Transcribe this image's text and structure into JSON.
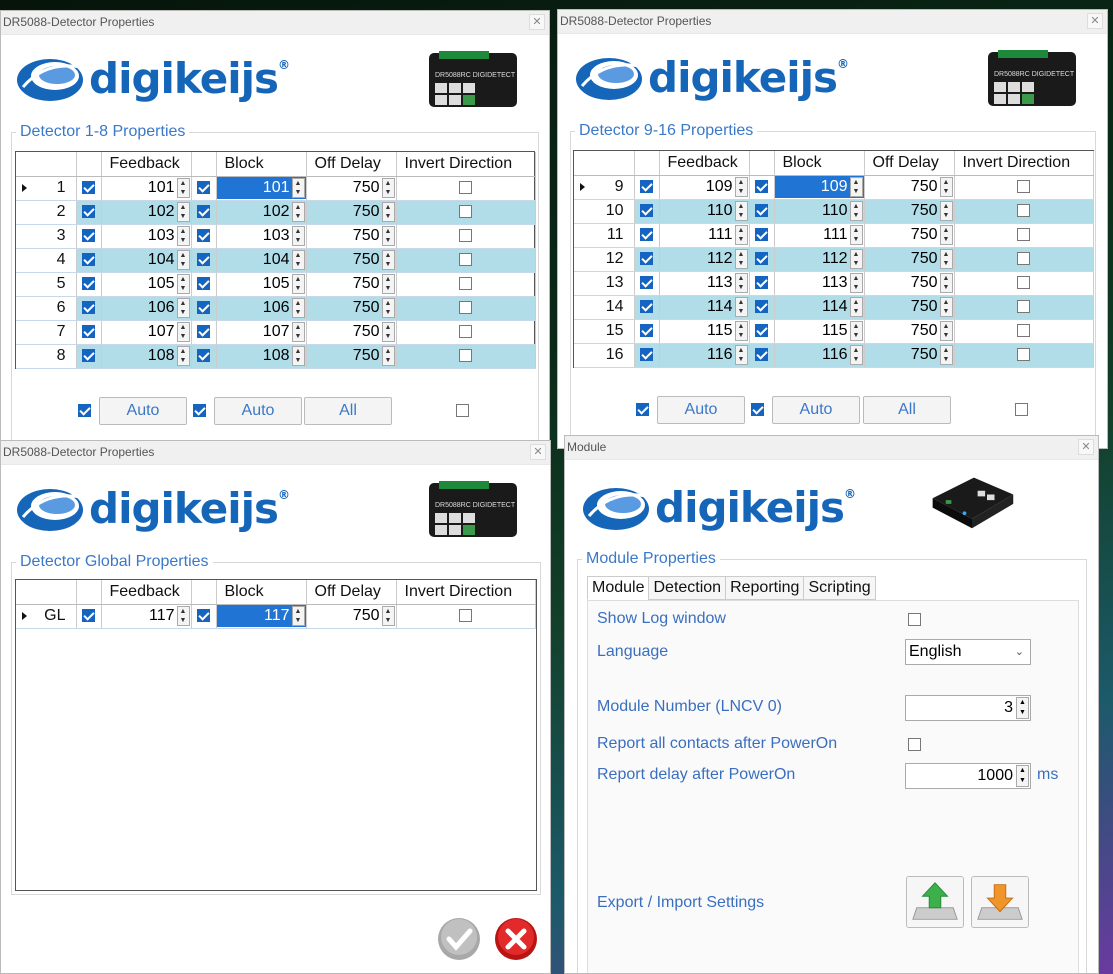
{
  "win1": {
    "title": "DR5088-Detector Properties",
    "legend": "Detector 1-8 Properties",
    "headers": [
      "Feedback",
      "Block",
      "Off Delay",
      "Invert Direction"
    ],
    "rows": [
      {
        "n": "1",
        "fb": "101",
        "bl": "101",
        "od": "750"
      },
      {
        "n": "2",
        "fb": "102",
        "bl": "102",
        "od": "750"
      },
      {
        "n": "3",
        "fb": "103",
        "bl": "103",
        "od": "750"
      },
      {
        "n": "4",
        "fb": "104",
        "bl": "104",
        "od": "750"
      },
      {
        "n": "5",
        "fb": "105",
        "bl": "105",
        "od": "750"
      },
      {
        "n": "6",
        "fb": "106",
        "bl": "106",
        "od": "750"
      },
      {
        "n": "7",
        "fb": "107",
        "bl": "107",
        "od": "750"
      },
      {
        "n": "8",
        "fb": "108",
        "bl": "108",
        "od": "750"
      }
    ],
    "auto1": "Auto",
    "auto2": "Auto",
    "all": "All"
  },
  "win2": {
    "title": "DR5088-Detector Properties",
    "legend": "Detector 9-16 Properties",
    "headers": [
      "Feedback",
      "Block",
      "Off Delay",
      "Invert Direction"
    ],
    "rows": [
      {
        "n": "9",
        "fb": "109",
        "bl": "109",
        "od": "750"
      },
      {
        "n": "10",
        "fb": "110",
        "bl": "110",
        "od": "750"
      },
      {
        "n": "11",
        "fb": "111",
        "bl": "111",
        "od": "750"
      },
      {
        "n": "12",
        "fb": "112",
        "bl": "112",
        "od": "750"
      },
      {
        "n": "13",
        "fb": "113",
        "bl": "113",
        "od": "750"
      },
      {
        "n": "14",
        "fb": "114",
        "bl": "114",
        "od": "750"
      },
      {
        "n": "15",
        "fb": "115",
        "bl": "115",
        "od": "750"
      },
      {
        "n": "16",
        "fb": "116",
        "bl": "116",
        "od": "750"
      }
    ],
    "auto1": "Auto",
    "auto2": "Auto",
    "all": "All"
  },
  "win3": {
    "title": "DR5088-Detector Properties",
    "legend": "Detector Global Properties",
    "headers": [
      "Feedback",
      "Block",
      "Off Delay",
      "Invert Direction"
    ],
    "row": {
      "n": "GL",
      "fb": "117",
      "bl": "117",
      "od": "750"
    }
  },
  "win4": {
    "title": "Module",
    "legend": "Module Properties",
    "tabs": [
      "Module",
      "Detection",
      "Reporting",
      "Scripting"
    ],
    "show_log": "Show Log window",
    "language_label": "Language",
    "language_value": "English",
    "module_number_label": "Module Number (LNCV 0)",
    "module_number": "3",
    "report_all": "Report all contacts after PowerOn",
    "report_delay_label": "Report delay after PowerOn",
    "report_delay": "1000",
    "ms": "ms",
    "export_import": "Export / Import Settings"
  },
  "logo_text": "digikeijs",
  "logo_reg": "®",
  "device_label": "DR5088RC DIGIDETECT",
  "colors": {
    "accent": "#1565b8",
    "label_blue": "#3a78c8",
    "row_alt": "#b0dde8",
    "selection": "#1f74d4"
  }
}
